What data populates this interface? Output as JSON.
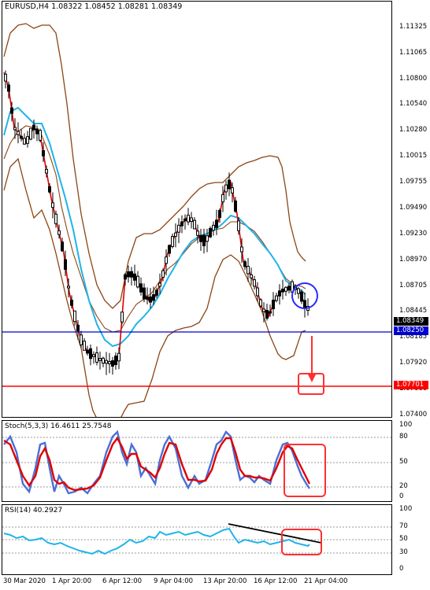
{
  "main": {
    "title": "EURUSD,H4  1.08322 1.08452 1.08281 1.08349",
    "price_axis": [
      "1.11325",
      "1.11065",
      "1.10800",
      "1.10540",
      "1.10280",
      "1.10015",
      "1.09755",
      "1.09490",
      "1.09230",
      "1.08970",
      "1.08705",
      "1.08445",
      "1.08185",
      "1.07920",
      "1.07660",
      "1.07400"
    ],
    "current_price": "1.08349",
    "support_line": "1.08250",
    "target_line": "1.07701",
    "colors": {
      "candles": "#000000",
      "bands": "#8b4513",
      "ma_fast": "#ff0000",
      "ma_slow": "#1fb4e8",
      "support": "#0000cc",
      "target": "#ff0000"
    }
  },
  "stoch": {
    "label": "Stoch(5,3,3) 16.4611 25.7548",
    "levels": [
      "100",
      "80",
      "50",
      "20",
      "0"
    ]
  },
  "rsi": {
    "label": "RSI(14) 40.2927",
    "levels": [
      "100",
      "70",
      "50",
      "30",
      "0"
    ]
  },
  "time_axis": [
    "30 Mar 2020",
    "1 Apr 20:00",
    "6 Apr 12:00",
    "9 Apr 04:00",
    "13 Apr 20:00",
    "16 Apr 12:00",
    "21 Apr 04:00"
  ]
}
